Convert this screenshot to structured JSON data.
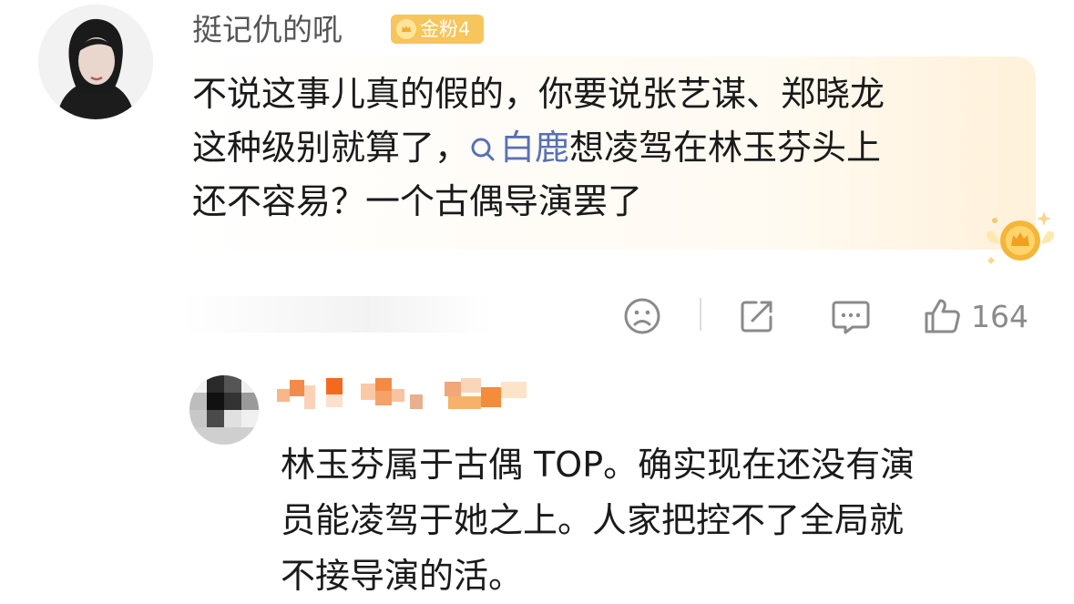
{
  "comment": {
    "username": "挺记仇的吼",
    "badge": "金粉4",
    "lines": [
      "不说这事儿真的假的，你要说张艺谋、郑晓龙",
      "这种级别就算了，",
      "想凌驾在林玉芬头上",
      "还不容易？一个古偶导演罢了"
    ],
    "topic": "白鹿"
  },
  "actions": {
    "like_count": "164",
    "icons": [
      "dislike-face-icon",
      "share-icon",
      "comment-icon",
      "like-icon"
    ]
  },
  "reply": {
    "lines": [
      "林玉芬属于古偶 TOP。确实现在还没有演",
      "员能凌驾于她之上。人家把控不了全局就",
      "不接导演的活。"
    ]
  },
  "colors": {
    "topic": "#5871b4",
    "badge": "#f6c55b",
    "muted": "#8a8a8a"
  }
}
